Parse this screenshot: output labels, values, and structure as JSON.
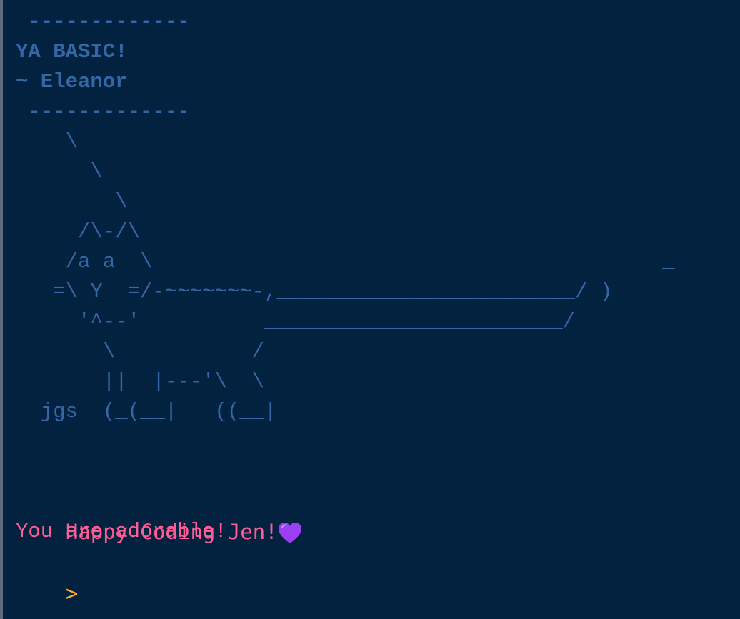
{
  "colors": {
    "background": "#022240",
    "ascii_art": "#3567a6",
    "message": "#ff5d95",
    "prompt": "#ffab2e",
    "heart": "#9b3ff0"
  },
  "banner": {
    "top_rule": " -------------",
    "title": "YA BASIC!",
    "signature": "~ Eleanor",
    "bottom_rule": " -------------"
  },
  "ascii_art": {
    "lines": [
      "    \\",
      "      \\",
      "        \\",
      "     /\\-/\\",
      "    /a a  \\                                         _",
      "   =\\ Y  =/-~~~~~~~-,________________________/ )",
      "     '^--'          ________________________/",
      "       \\           /",
      "       ||  |---'\\  \\",
      "  jgs  (_(__|   ((__|"
    ]
  },
  "messages": {
    "greeting": "Happy Coding Jen!",
    "greeting_icon": "purple-heart-icon",
    "compliment": "You are adorable!"
  },
  "prompt": {
    "symbol": ">"
  }
}
